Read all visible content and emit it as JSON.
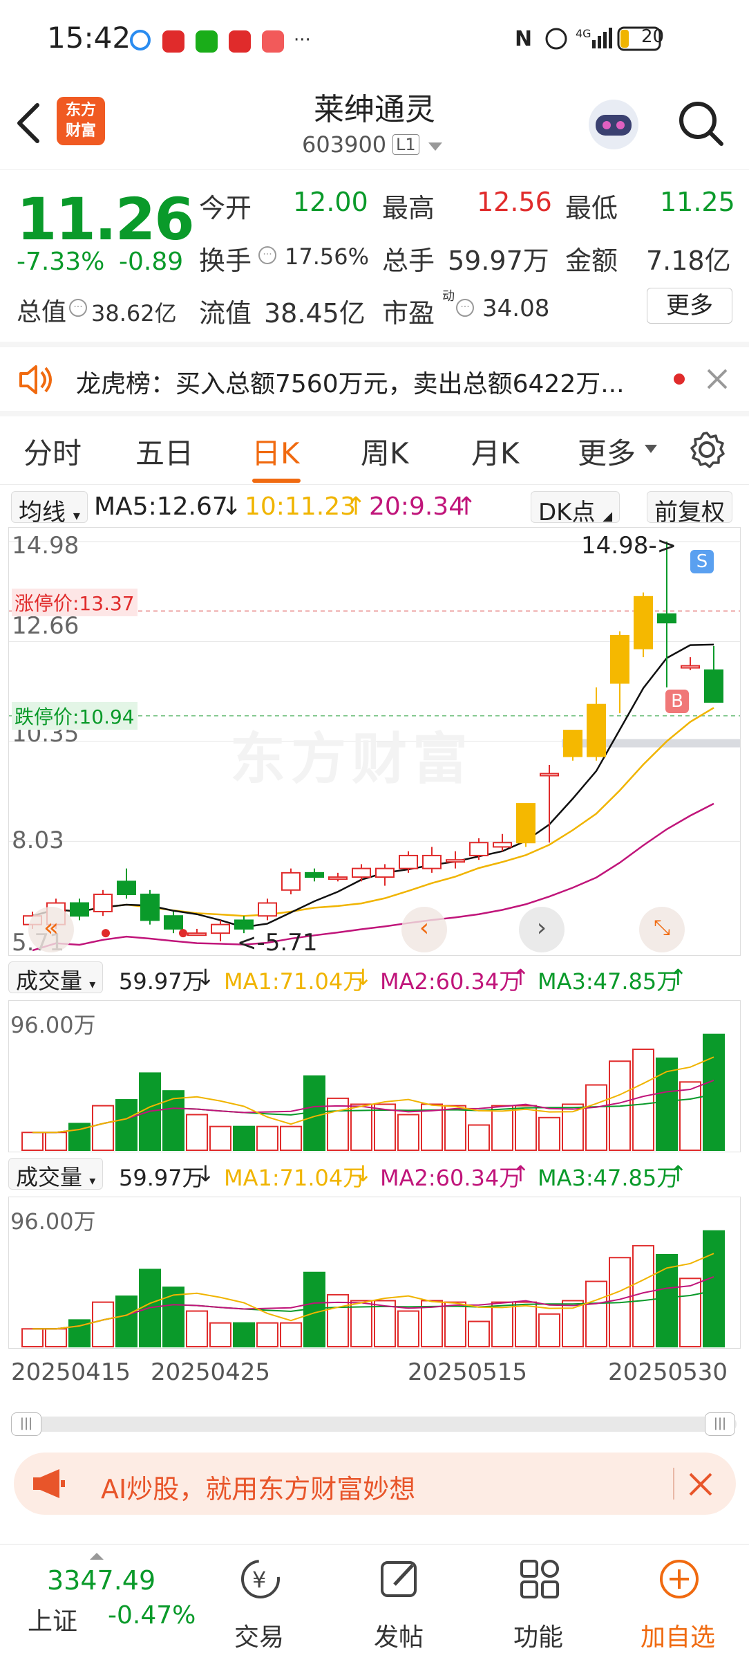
{
  "status": {
    "time": "15:42",
    "battery": "20",
    "network": "4G"
  },
  "header": {
    "back_icon": "chevron-left-icon",
    "logo_text": "东方\n财富",
    "title": "莱绅通灵",
    "code": "603900",
    "level": "L1"
  },
  "quote": {
    "price": "11.26",
    "change_pct": "-7.33%",
    "change": "-0.89",
    "open_label": "今开",
    "open": "12.00",
    "high_label": "最高",
    "high": "12.56",
    "low_label": "最低",
    "low": "11.25",
    "turnover_label": "换手",
    "turnover": "17.56%",
    "volume_label": "总手",
    "volume": "59.97万",
    "amount_label": "金额",
    "amount": "7.18亿",
    "mktcap_label": "总值",
    "mktcap": "38.62亿",
    "float_label": "流值",
    "float_cap": "38.45亿",
    "pe_label": "市盈",
    "pe_sup": "动",
    "pe": "34.08",
    "more_button": "更多"
  },
  "notice": {
    "text": "龙虎榜：买入总额7560万元，卖出总额6422万..."
  },
  "tabs": [
    "分时",
    "五日",
    "日K",
    "周K",
    "月K",
    "更多"
  ],
  "active_tab": "日K",
  "ma_bar": {
    "select": "均线",
    "ma5": "MA5:12.67",
    "ma10": "10:11.23",
    "ma20": "20:9.34",
    "dk": "DK点",
    "fq": "前复权"
  },
  "kline": {
    "y_labels": [
      "14.98",
      "12.66",
      "10.35",
      "8.03",
      "5.71"
    ],
    "limit_up": "涨停价:13.37",
    "limit_down": "跌停价:10.94",
    "max_marker": "14.98->",
    "min_marker": "<-5.71",
    "buy_tag": "B",
    "sell_tag": "S",
    "watermark": "东方财富"
  },
  "vol1": {
    "select": "成交量",
    "vol": "59.97万",
    "ma1": "MA1:71.04万",
    "ma2": "MA2:60.34万",
    "ma3": "MA3:47.85万",
    "ylabel": "96.00万"
  },
  "vol2": {
    "select": "成交量",
    "vol": "59.97万",
    "ma1": "MA1:71.04万",
    "ma2": "MA2:60.34万",
    "ma3": "MA3:47.85万",
    "ylabel": "96.00万"
  },
  "dates": [
    "20250415",
    "20250425",
    "20250515",
    "20250530"
  ],
  "banner": {
    "text": "AI炒股，就用东方财富妙想"
  },
  "bottom": {
    "index_value": "3347.49",
    "index_name": "上证",
    "index_change": "-0.47%",
    "items": [
      "交易",
      "发帖",
      "功能",
      "加自选"
    ]
  },
  "colors": {
    "up": "#e02b2b",
    "down": "#0a9a2a",
    "accent": "#f06a10",
    "ma5": "#111111",
    "ma10": "#f0b400",
    "ma20": "#c0157a"
  },
  "chart_data": {
    "type": "candlestick",
    "candles": [
      {
        "o": 6.1,
        "c": 6.3,
        "h": 6.4,
        "l": 6.0
      },
      {
        "o": 6.1,
        "c": 6.6,
        "h": 6.7,
        "l": 6.0
      },
      {
        "o": 6.6,
        "c": 6.3,
        "h": 6.7,
        "l": 6.2
      },
      {
        "o": 6.4,
        "c": 6.8,
        "h": 6.9,
        "l": 6.3
      },
      {
        "o": 7.1,
        "c": 6.8,
        "h": 7.4,
        "l": 6.7
      },
      {
        "o": 6.8,
        "c": 6.2,
        "h": 6.9,
        "l": 6.1
      },
      {
        "o": 6.3,
        "c": 6.0,
        "h": 6.4,
        "l": 5.9
      },
      {
        "o": 5.9,
        "c": 5.9,
        "h": 6.0,
        "l": 5.85
      },
      {
        "o": 5.9,
        "c": 6.1,
        "h": 6.2,
        "l": 5.71
      },
      {
        "o": 6.2,
        "c": 6.0,
        "h": 6.3,
        "l": 5.9
      },
      {
        "o": 6.3,
        "c": 6.6,
        "h": 6.7,
        "l": 6.2
      },
      {
        "o": 6.9,
        "c": 7.3,
        "h": 7.4,
        "l": 6.8
      },
      {
        "o": 7.3,
        "c": 7.2,
        "h": 7.4,
        "l": 7.1
      },
      {
        "o": 7.2,
        "c": 7.2,
        "h": 7.3,
        "l": 7.1
      },
      {
        "o": 7.2,
        "c": 7.4,
        "h": 7.5,
        "l": 7.1
      },
      {
        "o": 7.2,
        "c": 7.4,
        "h": 7.5,
        "l": 7.0
      },
      {
        "o": 7.4,
        "c": 7.7,
        "h": 7.8,
        "l": 7.3
      },
      {
        "o": 7.4,
        "c": 7.7,
        "h": 7.9,
        "l": 7.3
      },
      {
        "o": 7.6,
        "c": 7.6,
        "h": 7.8,
        "l": 7.4
      },
      {
        "o": 7.7,
        "c": 8.0,
        "h": 8.1,
        "l": 7.6
      },
      {
        "o": 7.9,
        "c": 8.0,
        "h": 8.2,
        "l": 7.8
      },
      {
        "o": 8.0,
        "c": 8.9,
        "h": 8.9,
        "l": 7.9
      },
      {
        "o": 9.6,
        "c": 9.6,
        "h": 9.8,
        "l": 8.0
      },
      {
        "o": 10.0,
        "c": 10.6,
        "h": 10.6,
        "l": 9.9
      },
      {
        "o": 10.0,
        "c": 11.2,
        "h": 11.6,
        "l": 9.9
      },
      {
        "o": 11.7,
        "c": 12.8,
        "h": 12.9,
        "l": 11.0
      },
      {
        "o": 12.5,
        "c": 13.7,
        "h": 13.8,
        "l": 12.3
      },
      {
        "o": 13.3,
        "c": 13.1,
        "h": 14.98,
        "l": 11.6
      },
      {
        "o": 12.1,
        "c": 12.1,
        "h": 12.3,
        "l": 12.0
      },
      {
        "o": 12.0,
        "c": 11.26,
        "h": 12.56,
        "l": 11.25
      }
    ],
    "ylim": [
      5.71,
      14.98
    ],
    "volumes": [
      12,
      12,
      18,
      30,
      34,
      52,
      40,
      24,
      16,
      16,
      16,
      16,
      50,
      35,
      31,
      31,
      24,
      31,
      30,
      17,
      30,
      30,
      22,
      31,
      44,
      60,
      68,
      62,
      46,
      78
    ],
    "vol_ylim": [
      0,
      96
    ]
  }
}
